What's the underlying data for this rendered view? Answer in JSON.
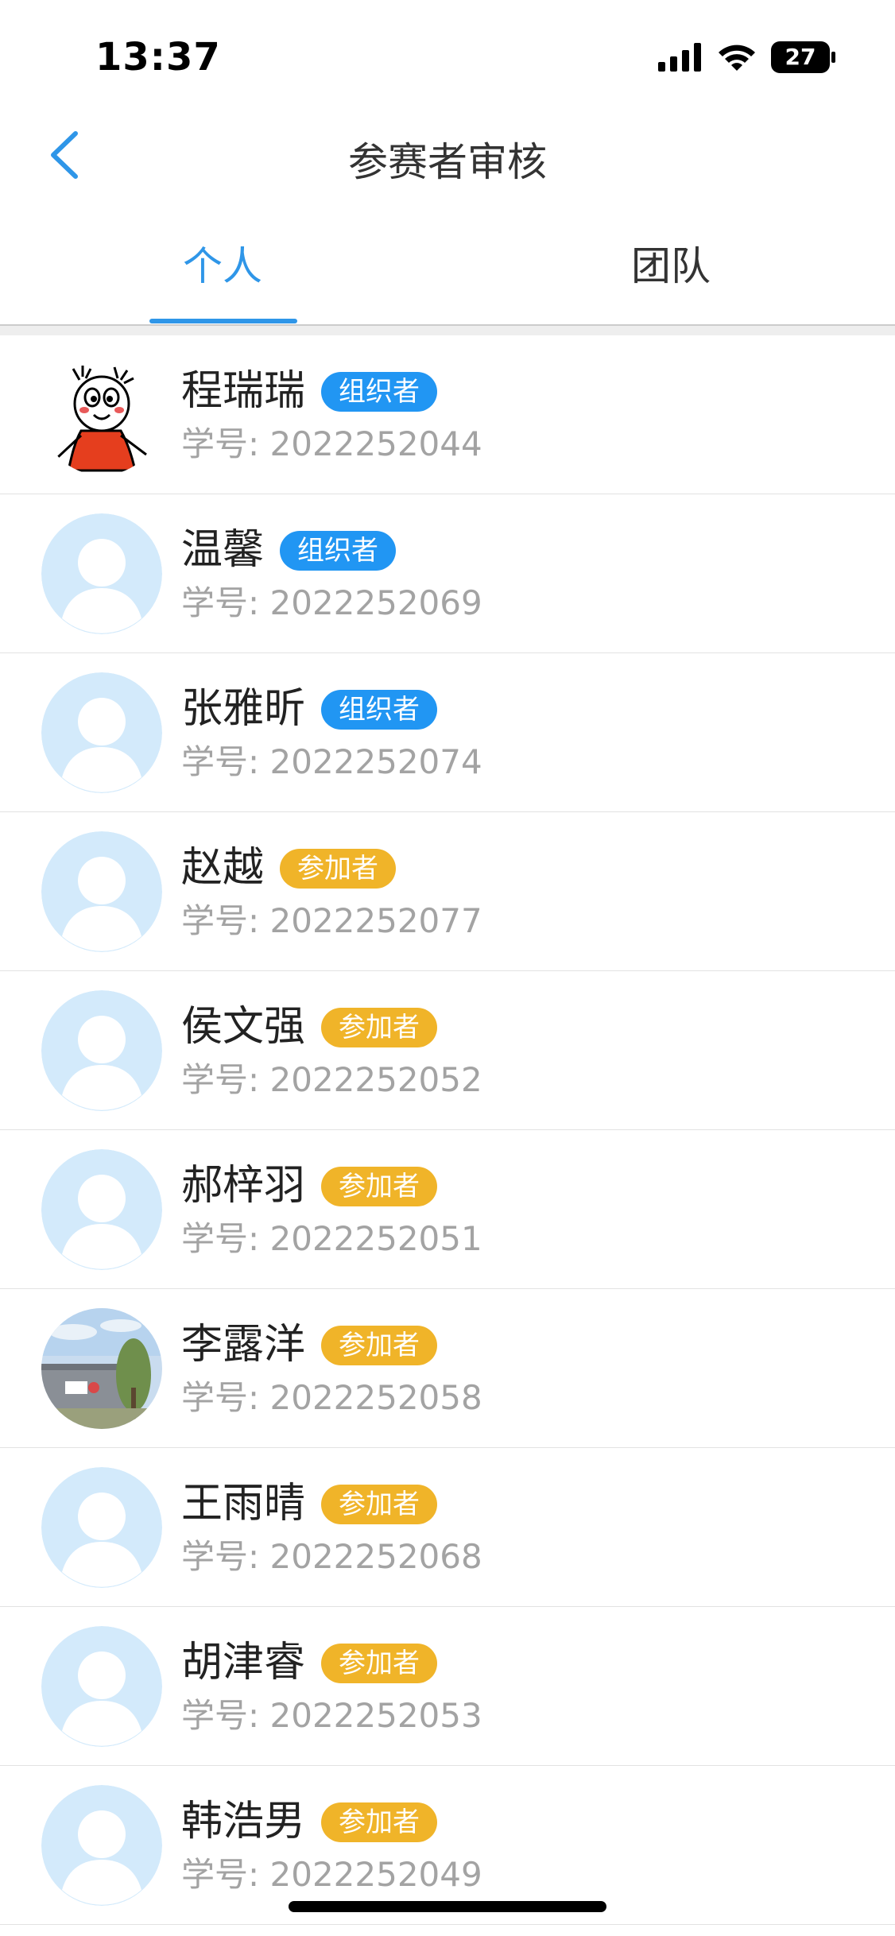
{
  "status_bar": {
    "time": "13:37",
    "battery": "27"
  },
  "nav": {
    "title": "参赛者审核",
    "back_icon": "chevron-left-icon"
  },
  "tabs": [
    {
      "label": "个人",
      "active": true
    },
    {
      "label": "团队",
      "active": false
    }
  ],
  "colors": {
    "accent": "#2F96E8",
    "organizer": "#2196F3",
    "participant": "#F0B429",
    "id_text": "#A3A3A3",
    "placeholder_avatar": "#D3EAFB"
  },
  "members": [
    {
      "name": "程瑞瑞",
      "role": "组织者",
      "role_type": "organizer",
      "id": "学号: 2022252044",
      "avatar": "cartoon-girl-avatar"
    },
    {
      "name": "温馨",
      "role": "组织者",
      "role_type": "organizer",
      "id": "学号: 2022252069",
      "avatar": "default-avatar"
    },
    {
      "name": "张雅昕",
      "role": "组织者",
      "role_type": "organizer",
      "id": "学号: 2022252074",
      "avatar": "default-avatar"
    },
    {
      "name": "赵越",
      "role": "参加者",
      "role_type": "participant",
      "id": "学号: 2022252077",
      "avatar": "default-avatar"
    },
    {
      "name": "侯文强",
      "role": "参加者",
      "role_type": "participant",
      "id": "学号: 2022252052",
      "avatar": "default-avatar"
    },
    {
      "name": "郝梓羽",
      "role": "参加者",
      "role_type": "participant",
      "id": "学号: 2022252051",
      "avatar": "default-avatar"
    },
    {
      "name": "李露洋",
      "role": "参加者",
      "role_type": "participant",
      "id": "学号: 2022252058",
      "avatar": "building-photo-avatar"
    },
    {
      "name": "王雨晴",
      "role": "参加者",
      "role_type": "participant",
      "id": "学号: 2022252068",
      "avatar": "default-avatar"
    },
    {
      "name": "胡津睿",
      "role": "参加者",
      "role_type": "participant",
      "id": "学号: 2022252053",
      "avatar": "default-avatar"
    },
    {
      "name": "韩浩男",
      "role": "参加者",
      "role_type": "participant",
      "id": "学号: 2022252049",
      "avatar": "default-avatar"
    }
  ]
}
